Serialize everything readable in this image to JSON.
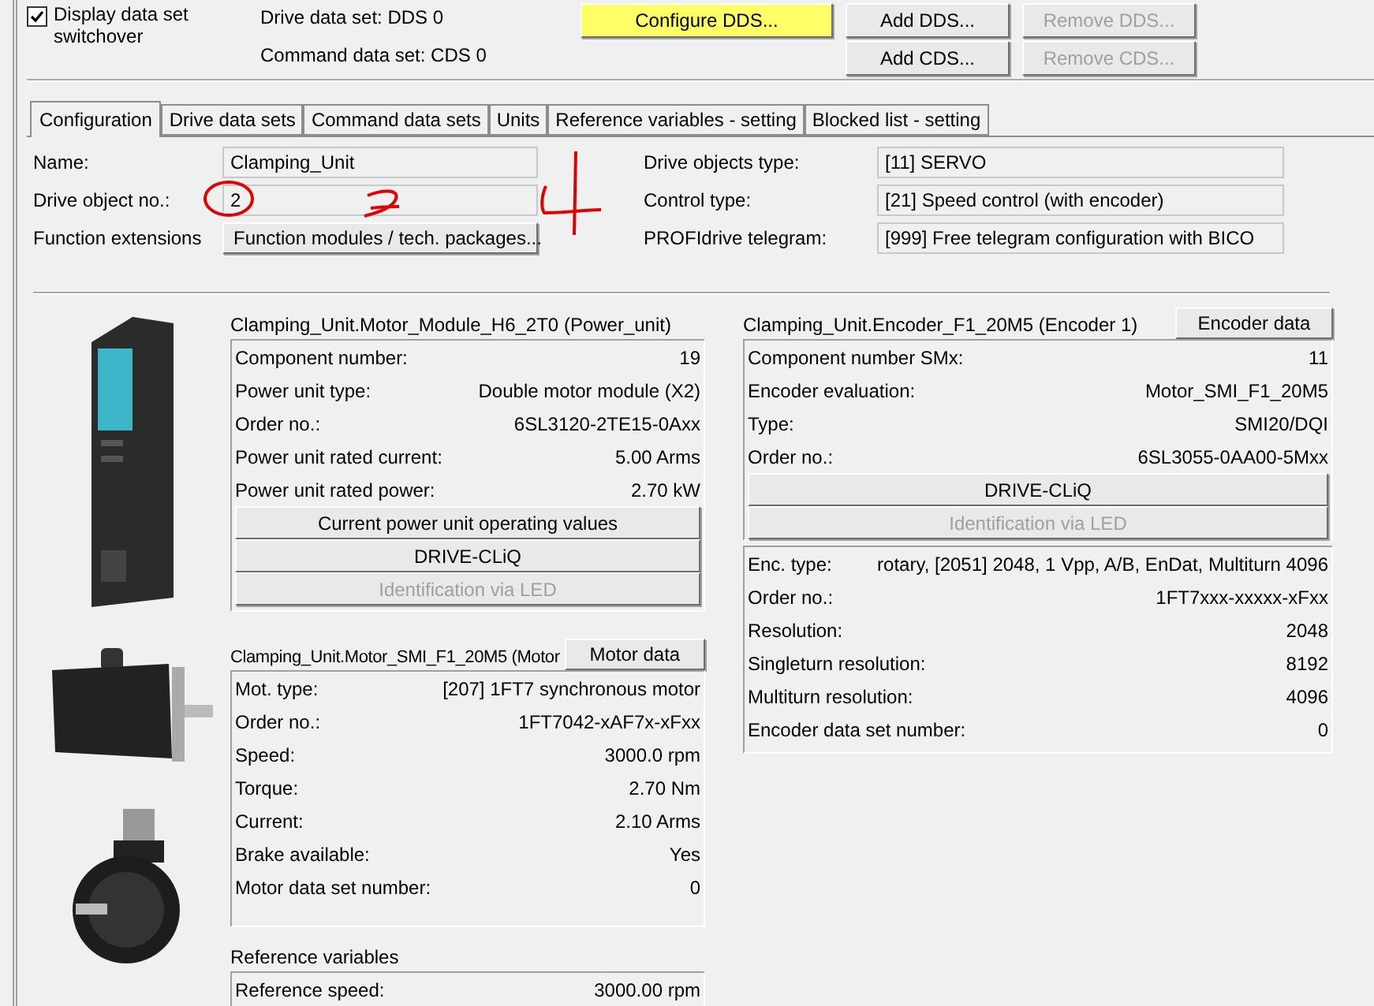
{
  "top": {
    "checkbox": {
      "label": "Display data set switchover",
      "checked": true
    },
    "data_sets": [
      "Drive data set: DDS 0",
      "Command data set: CDS 0"
    ],
    "buttons": [
      {
        "label": "Configure DDS...",
        "disabled": false,
        "highlighted": true
      },
      {
        "label": "Add DDS...",
        "disabled": false,
        "highlighted": false
      },
      {
        "label": "Remove DDS...",
        "disabled": true,
        "highlighted": false
      },
      {
        "label": "Add CDS...",
        "disabled": false,
        "highlighted": false
      },
      {
        "label": "Remove CDS...",
        "disabled": true,
        "highlighted": false
      }
    ]
  },
  "tabs": [
    {
      "label": "Configuration",
      "selected": true
    },
    {
      "label": "Drive data sets",
      "selected": false
    },
    {
      "label": "Command data sets",
      "selected": false
    },
    {
      "label": "Units",
      "selected": false
    },
    {
      "label": "Reference variables - setting",
      "selected": false
    },
    {
      "label": "Blocked list - setting",
      "selected": false
    }
  ],
  "general": {
    "left": [
      {
        "label": "Name:",
        "value": "Clamping_Unit",
        "kind": "field"
      },
      {
        "label": "Drive object no.:",
        "value": "2",
        "kind": "field"
      },
      {
        "label": "Function extensions",
        "value": "Function modules / tech. packages...",
        "kind": "button"
      }
    ],
    "right": [
      {
        "label": "Drive objects type:",
        "value": "[11] SERVO",
        "kind": "field"
      },
      {
        "label": "Control type:",
        "value": "[21] Speed control (with encoder)",
        "kind": "field"
      },
      {
        "label": "PROFIdrive telegram:",
        "value": "[999] Free telegram configuration with BICO",
        "kind": "field"
      }
    ]
  },
  "power_unit": {
    "title": "Clamping_Unit.Motor_Module_H6_2T0 (Power_unit)",
    "rows": [
      {
        "label": "Component number:",
        "value": "19"
      },
      {
        "label": "Power unit type:",
        "value": "Double motor module (X2)"
      },
      {
        "label": "Order no.:",
        "value": "6SL3120-2TE15-0Axx"
      },
      {
        "label": "Power unit rated current:",
        "value": "5.00 Arms"
      },
      {
        "label": "Power unit rated power:",
        "value": "2.70 kW"
      }
    ],
    "buttons": [
      {
        "label": "Current power unit operating values",
        "disabled": false
      },
      {
        "label": "DRIVE-CLiQ",
        "disabled": false
      },
      {
        "label": "Identification via LED",
        "disabled": true
      }
    ]
  },
  "motor": {
    "title": "Clamping_Unit.Motor_SMI_F1_20M5 (Motor",
    "button": "Motor data",
    "rows": [
      {
        "label": "Mot. type:",
        "value": "[207] 1FT7 synchronous motor"
      },
      {
        "label": "Order no.:",
        "value": "1FT7042-xAF7x-xFxx"
      },
      {
        "label": "Speed:",
        "value": "3000.0 rpm"
      },
      {
        "label": "Torque:",
        "value": "2.70 Nm"
      },
      {
        "label": "Current:",
        "value": "2.10 Arms"
      },
      {
        "label": "Brake available:",
        "value": "Yes"
      },
      {
        "label": "Motor data set number:",
        "value": "0"
      }
    ]
  },
  "reference": {
    "title": "Reference variables",
    "rows": [
      {
        "label": "Reference speed:",
        "value": "3000.00 rpm"
      }
    ]
  },
  "encoder": {
    "title": "Clamping_Unit.Encoder_F1_20M5 (Encoder 1)",
    "button": "Encoder data",
    "rows": [
      {
        "label": "Component number SMx:",
        "value": "11"
      },
      {
        "label": "Encoder evaluation:",
        "value": "Motor_SMI_F1_20M5"
      },
      {
        "label": "Type:",
        "value": "SMI20/DQI"
      },
      {
        "label": "Order no.:",
        "value": "6SL3055-0AA00-5Mxx"
      }
    ],
    "buttons": [
      {
        "label": "DRIVE-CLiQ",
        "disabled": false
      },
      {
        "label": "Identification via LED",
        "disabled": true
      }
    ],
    "details": [
      {
        "label": "Enc. type:",
        "value": "rotary, [2051] 2048, 1 Vpp, A/B, EnDat, Multiturn 4096"
      },
      {
        "label": "Order no.:",
        "value": "1FT7xxx-xxxxx-xFxx"
      },
      {
        "label": "Resolution:",
        "value": "2048"
      },
      {
        "label": "Singleturn resolution:",
        "value": "8192"
      },
      {
        "label": "Multiturn resolution:",
        "value": "4096"
      },
      {
        "label": "Encoder data set number:",
        "value": "0"
      }
    ]
  }
}
